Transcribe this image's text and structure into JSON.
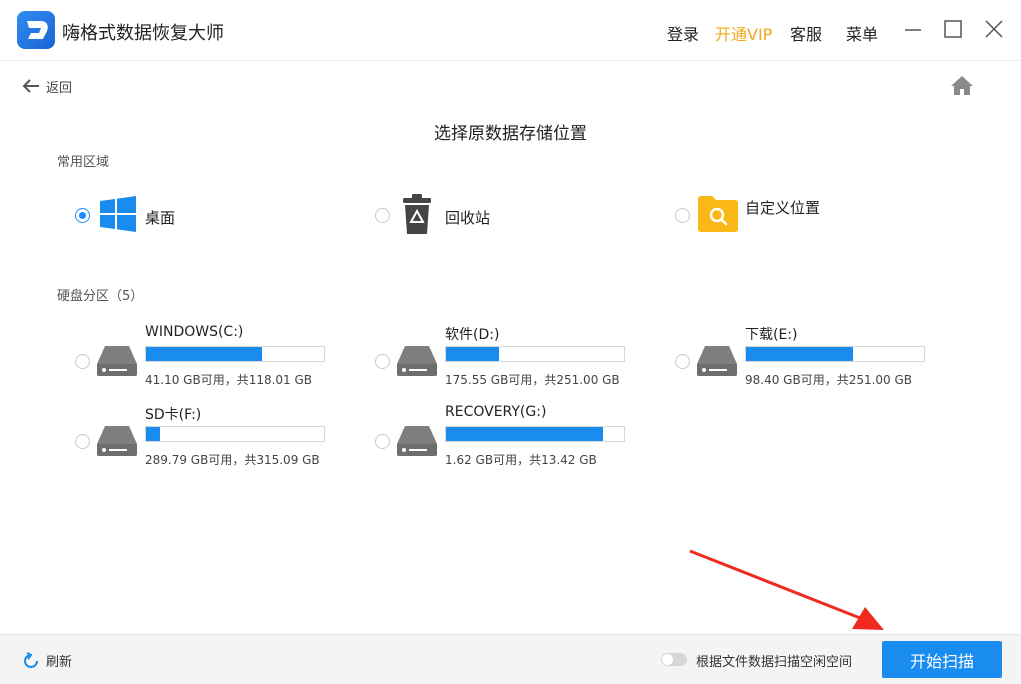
{
  "window": {
    "title": "嗨格式数据恢复大师",
    "links": {
      "login": "登录",
      "vip": "开通VIP",
      "service": "客服",
      "menu": "菜单"
    }
  },
  "nav": {
    "back_label": "返回"
  },
  "page": {
    "title": "选择原数据存储位置"
  },
  "common": {
    "label": "常用区域",
    "items": [
      {
        "label": "桌面",
        "icon": "windows-icon",
        "selected": true
      },
      {
        "label": "回收站",
        "icon": "recycle-bin-icon",
        "selected": false
      },
      {
        "label": "自定义位置",
        "icon": "folder-search-icon",
        "selected": false
      }
    ]
  },
  "disks": {
    "label": "硬盘分区（5）",
    "items": [
      {
        "name": "WINDOWS(C:)",
        "info": "41.10 GB可用，共118.01 GB",
        "used_percent": 65
      },
      {
        "name": "软件(D:)",
        "info": "175.55 GB可用，共251.00 GB",
        "used_percent": 30
      },
      {
        "name": "下载(E:)",
        "info": "98.40 GB可用，共251.00 GB",
        "used_percent": 60
      },
      {
        "name": "SD卡(F:)",
        "info": "289.79 GB可用，共315.09 GB",
        "used_percent": 8
      },
      {
        "name": "RECOVERY(G:)",
        "info": "1.62 GB可用，共13.42 GB",
        "used_percent": 88
      }
    ]
  },
  "footer": {
    "refresh_label": "刷新",
    "toggle_label": "根据文件数据扫描空闲空间",
    "toggle_on": false,
    "start_label": "开始扫描"
  },
  "colors": {
    "accent": "#1a8cf0",
    "vip": "#f0a81d",
    "annotation_arrow": "#f02a1e"
  }
}
